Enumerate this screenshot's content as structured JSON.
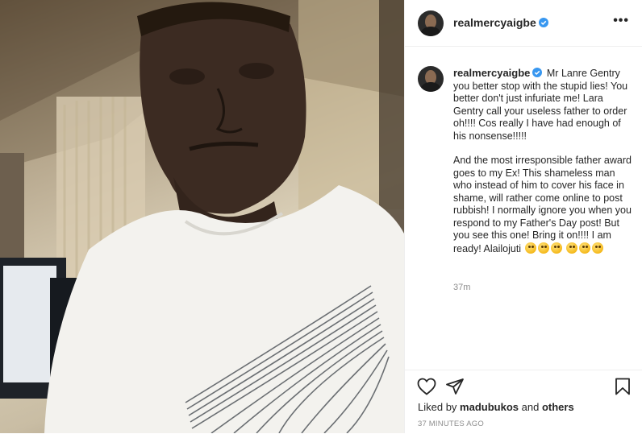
{
  "header": {
    "username": "realmercyaigbe",
    "verified": true,
    "more_label": "•••"
  },
  "caption": {
    "username": "realmercyaigbe",
    "paragraph1": "Mr Lanre Gentry you better stop with the stupid lies! You better don't just infuriate me! Lara Gentry call your useless father to order oh!!!! Cos really I have had enough of his nonsense!!!!!",
    "paragraph2": "And the most irresponsible father award goes to my Ex! This shameless man who instead of him to cover his face in shame, will rather come online to post rubbish! I normally ignore you when you respond to my Father's Day post! But you see this one! Bring it on!!!! I am ready! Alailojuti",
    "trailing_emoji": "flushed-face-emoji",
    "emoji_count_inline": 3,
    "emoji_count_after": 3,
    "time": "37m"
  },
  "actions": {
    "like_icon": "heart-icon",
    "share_icon": "send-icon",
    "save_icon": "bookmark-icon"
  },
  "likes": {
    "prefix": "Liked by",
    "user": "madubukos",
    "conj": "and",
    "others": "others"
  },
  "posted": "37 MINUTES AGO",
  "colors": {
    "text": "#262626",
    "muted": "#8e8e8e",
    "verified": "#3897f0",
    "border": "#efefef"
  }
}
